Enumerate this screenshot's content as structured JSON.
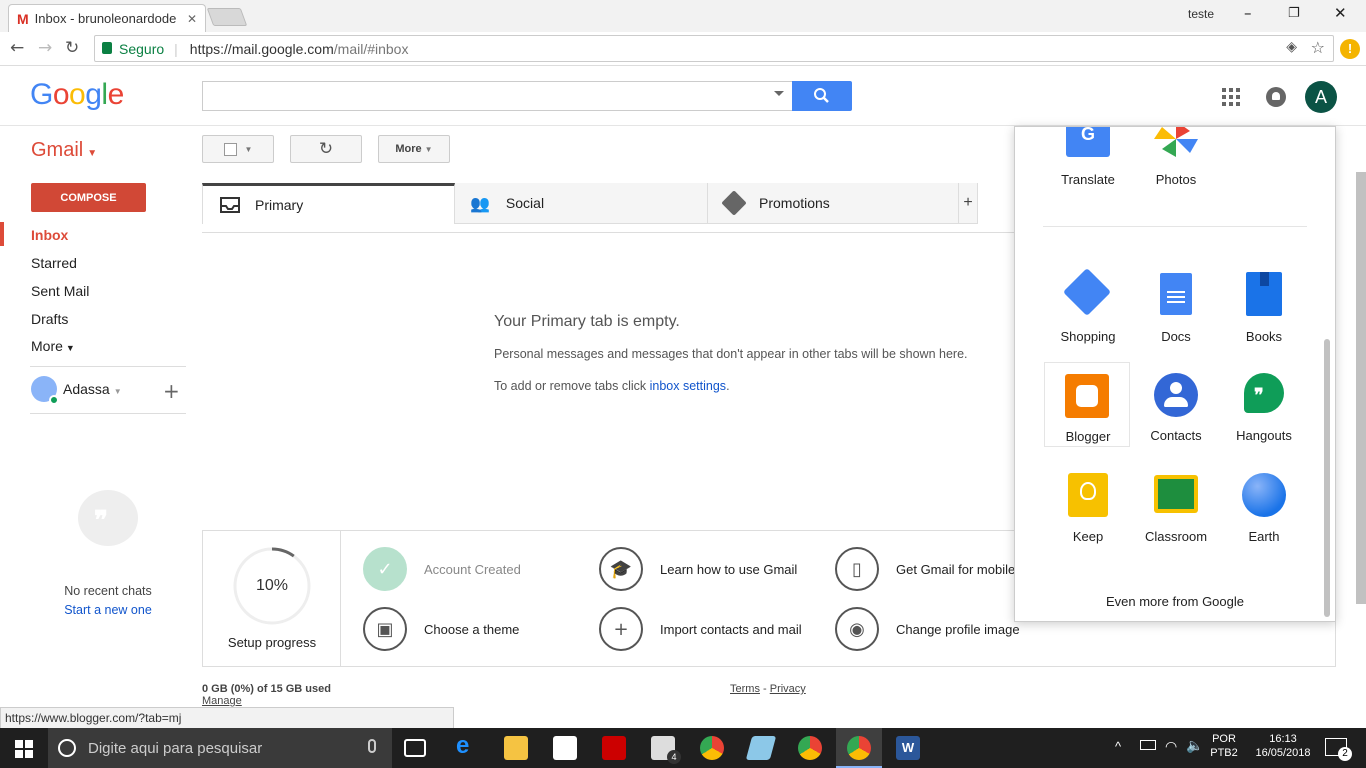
{
  "browser": {
    "tab_title": "Inbox - brunoleonardode",
    "window_user": "teste",
    "secure_label": "Seguro",
    "url_host": "https://mail.google.com",
    "url_path": "/mail/#inbox",
    "status_url": "https://www.blogger.com/?tab=mj"
  },
  "header": {
    "logo": "Google",
    "search_value": "",
    "avatar_letter": "A"
  },
  "toolbar": {
    "app_label": "Gmail",
    "more_label": "More"
  },
  "sidebar": {
    "compose": "COMPOSE",
    "items": [
      {
        "label": "Inbox",
        "active": true
      },
      {
        "label": "Starred"
      },
      {
        "label": "Sent Mail"
      },
      {
        "label": "Drafts"
      },
      {
        "label": "More"
      }
    ],
    "hangouts_user": "Adassa",
    "no_chats": "No recent chats",
    "start_new": "Start a new one"
  },
  "tabs": [
    {
      "label": "Primary",
      "selected": true
    },
    {
      "label": "Social"
    },
    {
      "label": "Promotions"
    }
  ],
  "empty": {
    "title": "Your Primary tab is empty.",
    "line1": "Personal messages and messages that don't appear in other tabs will be shown here.",
    "line2_prefix": "To add or remove tabs click ",
    "line2_link": "inbox settings",
    "line2_suffix": "."
  },
  "setup": {
    "progress_label": "10%",
    "progress_fraction": 0.1,
    "caption": "Setup progress",
    "steps": [
      "Account Created",
      "Learn how to use Gmail",
      "Get Gmail for mobile",
      "Choose a theme",
      "Import contacts and mail",
      "Change profile image"
    ]
  },
  "footer": {
    "storage": "0 GB (0%) of 15 GB used",
    "manage": "Manage",
    "terms": "Terms",
    "sep": " - ",
    "privacy": "Privacy"
  },
  "apps": {
    "top": [
      "Translate",
      "Photos"
    ],
    "grid": [
      "Shopping",
      "Docs",
      "Books",
      "Blogger",
      "Contacts",
      "Hangouts",
      "Keep",
      "Classroom",
      "Earth"
    ],
    "more": "Even more from Google"
  },
  "taskbar": {
    "search_placeholder": "Digite aqui para pesquisar",
    "mail_badge": "4",
    "lang1": "POR",
    "lang2": "PTB2",
    "time": "16:13",
    "date": "16/05/2018",
    "notif": "2"
  }
}
